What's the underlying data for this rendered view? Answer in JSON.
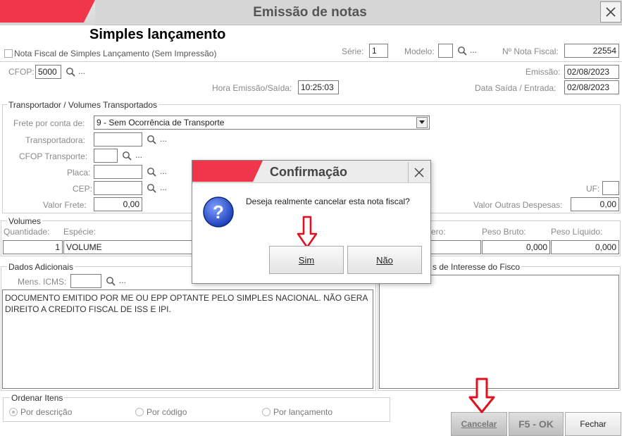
{
  "window": {
    "title": "Emissão de notas",
    "close_icon": "close-icon"
  },
  "header": {
    "page_title": "Simples lançamento",
    "checkbox_label": "Nota Fiscal de Simples Lançamento (Sem Impressão)",
    "serie_label": "Série:",
    "serie_value": "1",
    "modelo_label": "Modelo:",
    "modelo_value": "",
    "nf_label": "Nº Nota Fiscal:",
    "nf_value": "22554",
    "cfop_label": "CFOP:",
    "cfop_value": "5000",
    "emissao_label": "Emissão:",
    "emissao_value": "02/08/2023",
    "hora_label": "Hora Emissão/Saída:",
    "hora_value": "10:25:03",
    "data_saida_label": "Data Saída / Entrada:",
    "data_saida_value": "02/08/2023",
    "dots": "..."
  },
  "transport": {
    "group_title": "Transportador /  Volumes Transportados",
    "frete_label": "Frete por conta de:",
    "frete_value": "9 - Sem Ocorrência de Transporte",
    "transportadora_label": "Transportadora:",
    "cfop_transp_label": "CFOP Transporte:",
    "placa_label": "Placa:",
    "cep_label": "CEP:",
    "uf_label": "UF:",
    "valor_frete_label": "Valor Frete:",
    "valor_frete_value": "0,00",
    "outras_label": "Valor Outras Despesas:",
    "outras_value": "0,00"
  },
  "volumes": {
    "group_title": "Volumes",
    "quantidade_label": "Quantidade:",
    "quantidade_value": "1",
    "especie_label": "Espécie:",
    "especie_value": "VOLUME",
    "numero_label": "ero:",
    "peso_bruto_label": "Peso Bruto:",
    "peso_bruto_value": "0,000",
    "peso_liquido_label": "Peso Líquido:",
    "peso_liquido_value": "0,000"
  },
  "dados": {
    "group_title": "Dados Adicionais",
    "mens_label": "Mens. ICMS:",
    "text": "DOCUMENTO EMITIDO POR ME OU EPP OPTANTE PELO SIMPLES NACIONAL. NÃO GERA DIREITO A CREDITO FISCAL DE ISS E IPI.",
    "fisco_title": "s de Interesse do Fisco"
  },
  "ordenar": {
    "group_title": "Ordenar Itens",
    "opt1": "Por descrição",
    "opt2": "Por código",
    "opt3": "Por lançamento"
  },
  "buttons": {
    "cancelar": "Cancelar",
    "ok": "F5 - OK",
    "fechar": "Fechar"
  },
  "dialog": {
    "title": "Confirmação",
    "message": "Deseja realmente cancelar esta nota fiscal?",
    "sim": "Sim",
    "nao": "Não"
  },
  "colors": {
    "accent_red": "#f0364a",
    "arrow_red": "#e0101e"
  }
}
